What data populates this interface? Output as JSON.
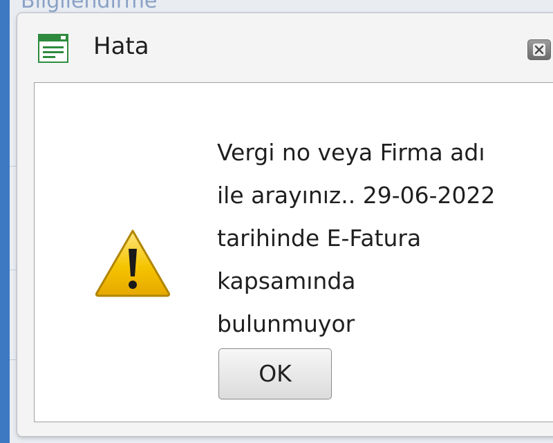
{
  "background": {
    "partial_text": "Bilgilendirme"
  },
  "dialog": {
    "title": "Hata",
    "icons": {
      "app": "window-app-icon",
      "close": "close-icon",
      "warning": "warning-icon"
    },
    "message_lines": [
      "Vergi no veya Firma adı",
      "ile arayınız.. 29-06-2022",
      "tarihinde E-Fatura",
      "kapsamında",
      "bulunmuyor"
    ],
    "ok_label": "OK"
  },
  "colors": {
    "accent_strip": "#3d79c3",
    "warning_yellow": "#f5c400",
    "app_icon_green": "#2e8b3e"
  }
}
